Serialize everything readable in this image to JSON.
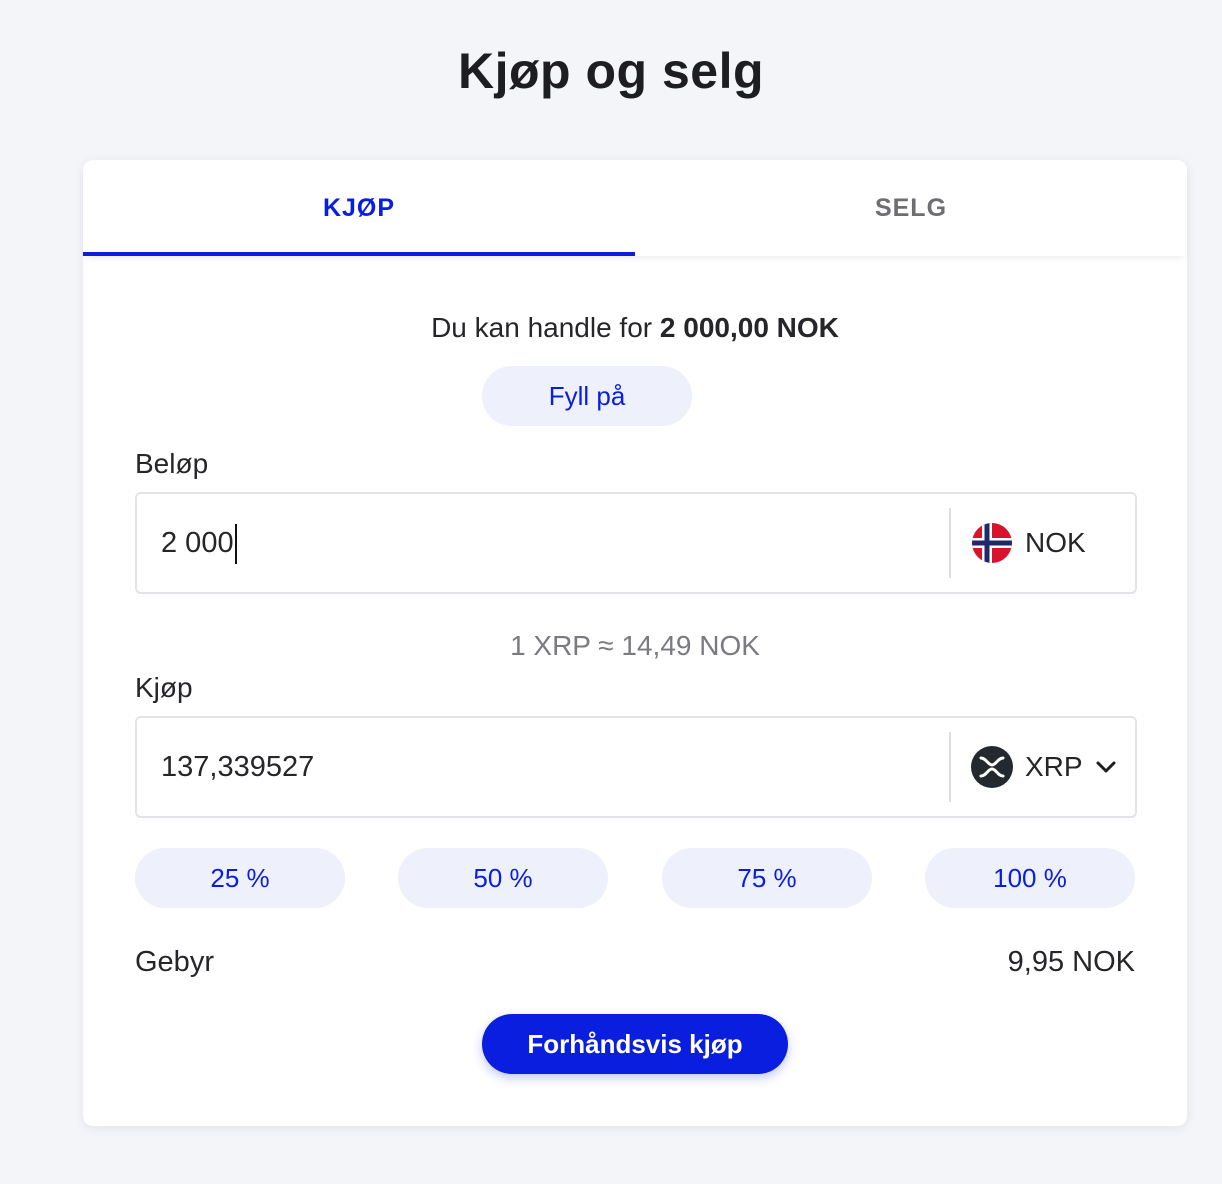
{
  "page": {
    "title": "Kjøp og selg"
  },
  "tabs": {
    "buy_label": "KJØP",
    "sell_label": "SELG"
  },
  "balance": {
    "prefix": "Du kan handle for",
    "amount": "2 000,00 NOK"
  },
  "fill_button_label": "Fyll på",
  "amount": {
    "label": "Beløp",
    "value": "2 000",
    "currency": "NOK",
    "currency_icon": "norway-flag-icon"
  },
  "rate_text": "1 XRP ≈ 14,49 NOK",
  "buy": {
    "label": "Kjøp",
    "value": "137,339527",
    "currency": "XRP",
    "currency_icon": "xrp-icon"
  },
  "percent_buttons": [
    "25 %",
    "50 %",
    "75 %",
    "100 %"
  ],
  "fee": {
    "label": "Gebyr",
    "value": "9,95 NOK"
  },
  "preview_button_label": "Forhåndsvis kjøp",
  "colors": {
    "accent": "#0a1ee0",
    "pill_bg": "#eef0fb",
    "background": "#f4f5f9"
  }
}
